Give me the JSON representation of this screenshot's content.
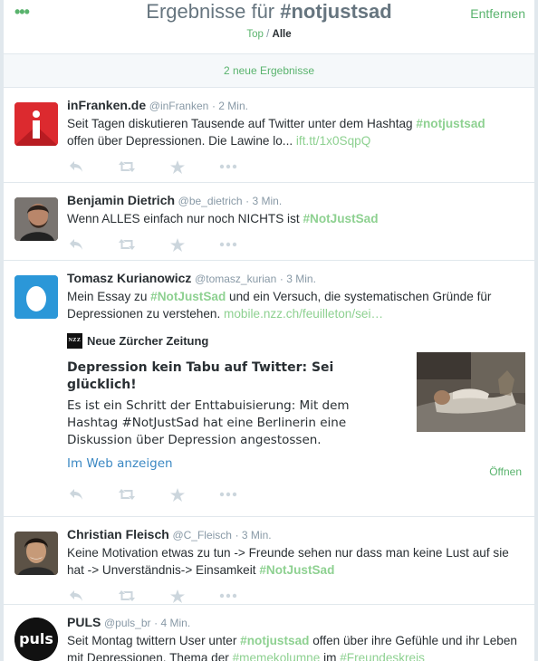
{
  "header": {
    "title_prefix": "Ergebnisse für ",
    "title_query": "#notjustsad",
    "remove_label": "Entfernen",
    "filter_top": "Top",
    "filter_separator": " / ",
    "filter_all": "Alle",
    "menu_dots": "•••"
  },
  "new_results_label": "2 neue Ergebnisse",
  "colors": {
    "accent": "#59b36d",
    "hashtag": "#8ed191",
    "link_blue": "#3b88c3"
  },
  "tweets": [
    {
      "name": "inFranken.de",
      "handle": "@inFranken",
      "time": "· 2 Min.",
      "text_a": "Seit Tagen diskutieren Tausende auf Twitter unter dem Hashtag ",
      "tag_a": "#notjustsad",
      "text_b": "offen über Depressionen. Die Lawine lo... ",
      "link": "ift.tt/1x0SqpQ",
      "avatar_glyph": "i"
    },
    {
      "name": "Benjamin Dietrich",
      "handle": "@be_dietrich",
      "time": "· 3 Min.",
      "text_a": "Wenn ALLES einfach nur noch NICHTS ist ",
      "tag_a": "#NotJustSad"
    },
    {
      "name": "Tomasz Kurianowicz",
      "handle": "@tomasz_kurian",
      "time": "· 3 Min.",
      "text_a": "Mein Essay zu ",
      "tag_a": "#NotJustSad",
      "text_b": " und ein Versuch, die systematischen Gründe für Depressionen zu verstehen. ",
      "link": "mobile.nzz.ch/feuilleton/sei…",
      "card": {
        "source": "Neue Zürcher Zeitung",
        "logo_text": "NZZ",
        "title": "Depression kein Tabu auf Twitter: Sei glücklich!",
        "description": "Es ist ein Schritt der Enttabuisierung: Mit dem Hashtag #NotJustSad hat eine Berlinerin eine Diskussion über Depression angestossen.",
        "web_link": "Im Web anzeigen"
      },
      "open_label": "Öffnen"
    },
    {
      "name": "Christian Fleisch",
      "handle": "@C_Fleisch",
      "time": "· 3 Min.",
      "text_a": "Keine Motivation etwas zu tun -> Freunde sehen nur dass man keine Lust auf sie hat -> Unverständnis-> Einsamkeit ",
      "tag_a": "#NotJustSad"
    },
    {
      "name": "PULS",
      "handle": "@puls_br",
      "time": "· 4 Min.",
      "text_a": "Seit Montag twittern User unter ",
      "tag_a": "#notjustsad",
      "text_b": " offen über ihre Gefühle und ihr Leben mit Depressionen. Thema der ",
      "tag_b": "#memekolumne",
      "text_c": " im ",
      "tag_c": "#Freundeskreis",
      "avatar_text": "puls"
    }
  ],
  "actions": {
    "reply_icon": "reply-icon",
    "retweet_icon": "retweet-icon",
    "favorite_icon": "star-icon",
    "more_icon": "more-icon"
  }
}
